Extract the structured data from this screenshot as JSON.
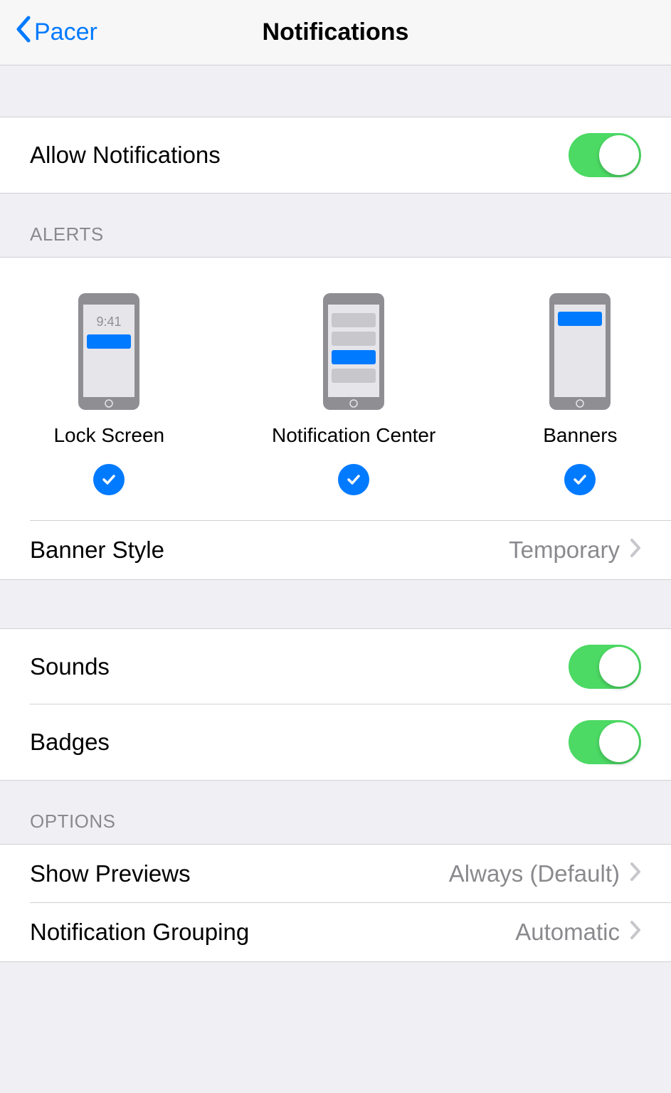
{
  "header": {
    "back_label": "Pacer",
    "title": "Notifications"
  },
  "allow": {
    "label": "Allow Notifications",
    "on": true
  },
  "alerts": {
    "header": "ALERTS",
    "lock_screen_label": "Lock Screen",
    "lock_screen_time": "9:41",
    "notification_center_label": "Notification Center",
    "banners_label": "Banners",
    "lock_screen_checked": true,
    "notification_center_checked": true,
    "banners_checked": true,
    "banner_style_label": "Banner Style",
    "banner_style_value": "Temporary"
  },
  "sounds": {
    "label": "Sounds",
    "on": true
  },
  "badges": {
    "label": "Badges",
    "on": true
  },
  "options": {
    "header": "OPTIONS",
    "show_previews_label": "Show Previews",
    "show_previews_value": "Always (Default)",
    "notification_grouping_label": "Notification Grouping",
    "notification_grouping_value": "Automatic"
  }
}
